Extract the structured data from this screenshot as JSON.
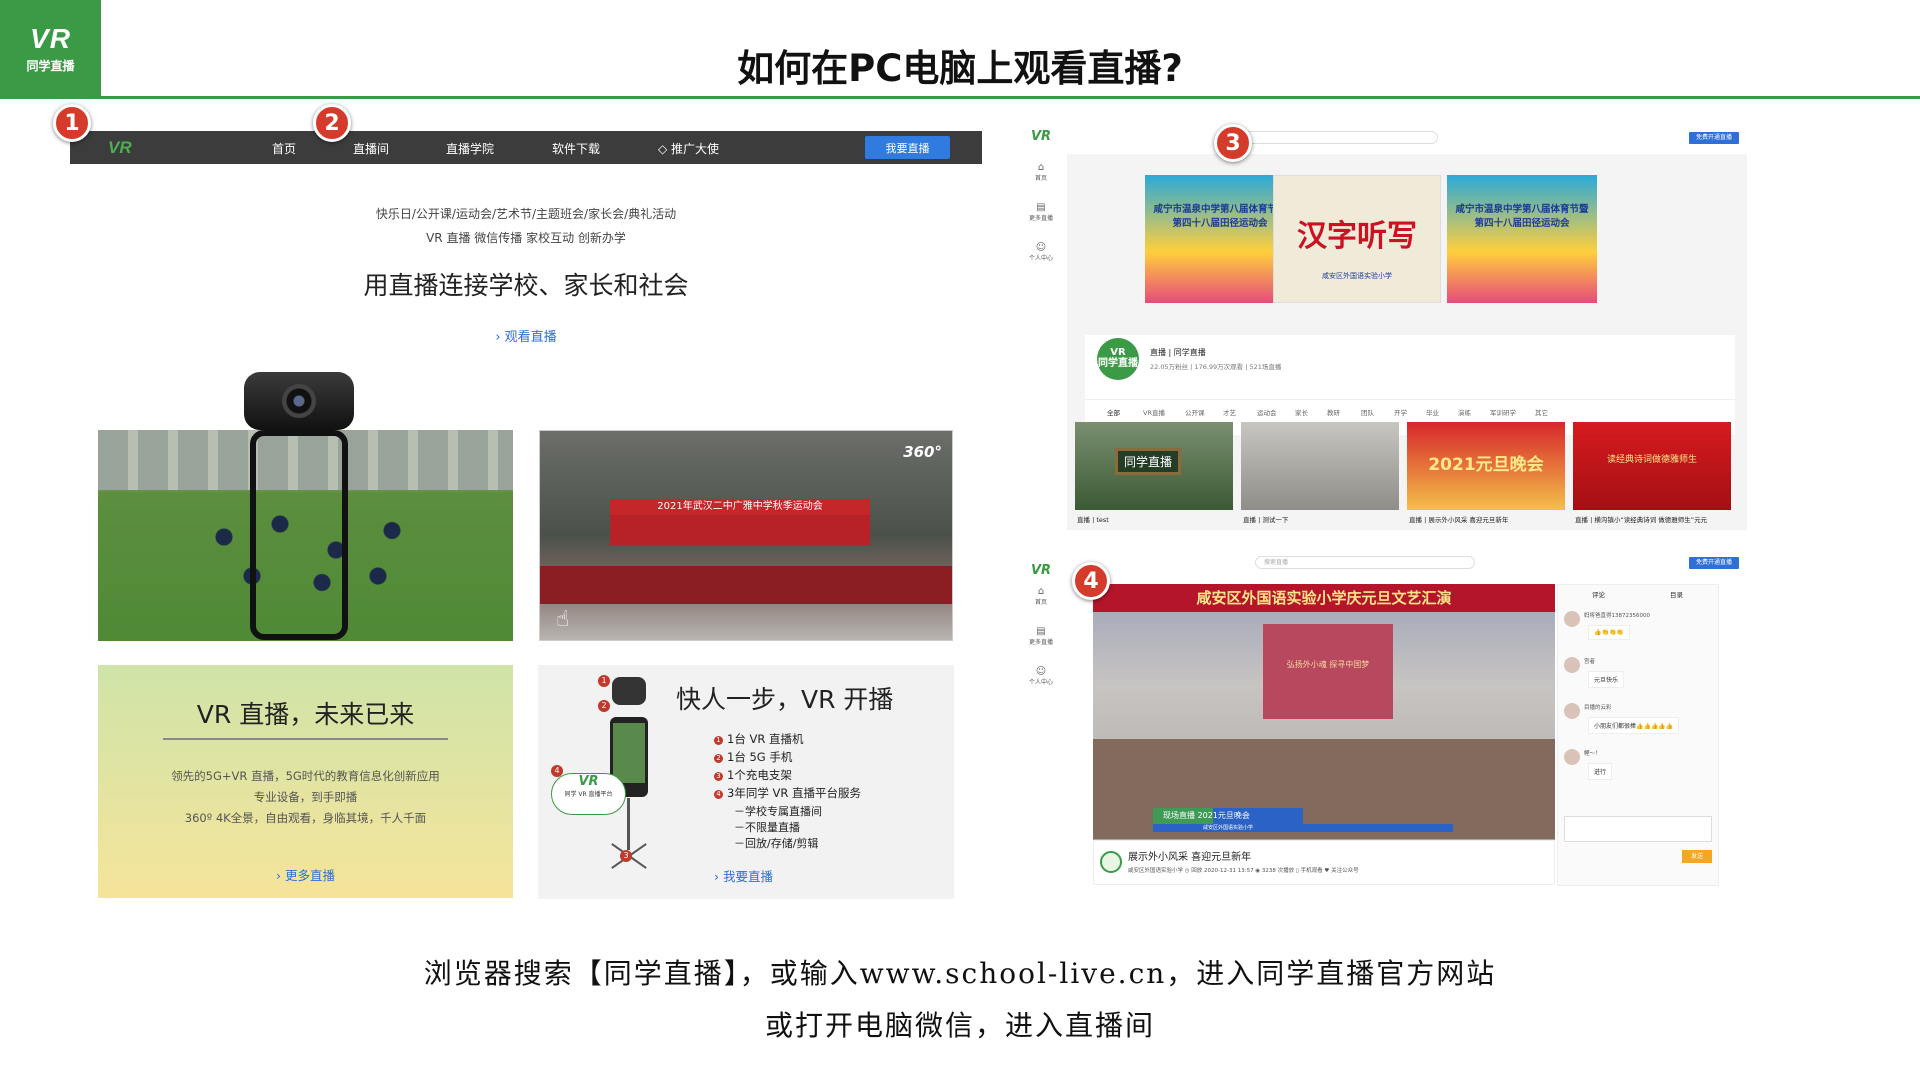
{
  "logo": {
    "mark": "VR",
    "name": "同学直播"
  },
  "title": "如何在PC电脑上观看直播?",
  "markers": [
    "1",
    "2",
    "3",
    "4"
  ],
  "site": {
    "nav": [
      "首页",
      "直播间",
      "直播学院",
      "软件下载",
      "推广大使"
    ],
    "nav_logo": "VR",
    "cta": "我要直播",
    "tagline1": "快乐日/公开课/运动会/艺术节/主题班会/家长会/典礼活动",
    "tagline2": "VR 直播  微信传播  家校互动  创新办学",
    "headline": "用直播连接学校、家长和社会",
    "watch": "观看直播",
    "img_right_banner": "2021年武汉二中广雅中学秋季运动会",
    "badge360": "360°",
    "cardA": {
      "title": "VR 直播，未来已来",
      "lines": [
        "领先的5G+VR 直播，5G时代的教育信息化创新应用",
        "专业设备，到手即播",
        "360º 4K全景，自由观看，身临其境，千人千面"
      ],
      "more": "更多直播"
    },
    "cardB": {
      "title": "快人一步，VR 开播",
      "items": [
        "1台 VR 直播机",
        "1台 5G 手机",
        "1个充电支架",
        "3年同学 VR 直播平台服务"
      ],
      "subs": [
        "－学校专属直播间",
        "－不限量直播",
        "－回放/存储/剪辑"
      ],
      "more": "我要直播",
      "cloud": "VR",
      "cloud_sub": "同学 VR 直播平台",
      "nums": [
        "1",
        "2",
        "3",
        "4"
      ]
    }
  },
  "shot1": {
    "logo": "VR",
    "side": [
      {
        "icon": "⌂",
        "label": "首页"
      },
      {
        "icon": "▤",
        "label": "更多直播"
      },
      {
        "icon": "☺",
        "label": "个人中心"
      }
    ],
    "search": "搜索直播",
    "btn": "免费开通直播",
    "car1": "咸宁市温泉中学第八届体育节暨第四十八届田径运动会",
    "car2": "汉字听写",
    "car2_sub": "咸安区外国语实验小学",
    "car3": "咸宁市温泉中学第八届体育节暨第四十八届田径运动会",
    "channel": {
      "avatar": "VR\n同学直播",
      "name": "直播 | 同学直播",
      "stats": "22.05万粉丝 | 176.99万次观看 | 521场直播"
    },
    "tabs": [
      "全部",
      "VR直播",
      "公开课",
      "才艺",
      "运动会",
      "家长",
      "教研",
      "团队",
      "开学",
      "毕业",
      "演练",
      "军训研学",
      "其它"
    ],
    "videos": [
      "直播 | test",
      "直播 | 测试一下",
      "直播 | 展示外小风采 喜迎元旦新年",
      "直播 | 横沟镇小“读经典诗词 做德雅师生”元元"
    ],
    "thumb_text": [
      "同学直播",
      "",
      "2021元旦晚会",
      "读经典诗词做德雅师生"
    ]
  },
  "shot2": {
    "logo": "VR",
    "side": [
      {
        "icon": "⌂",
        "label": "首页"
      },
      {
        "icon": "▤",
        "label": "更多直播"
      },
      {
        "icon": "☺",
        "label": "个人中心"
      }
    ],
    "search": "搜索直播",
    "btn": "免费开通直播",
    "banner": "咸安区外国语实验小学庆元旦文艺汇演",
    "screen": "弘扬外小魂 探寻中国梦",
    "lower": "现场直播  2021元旦晚会",
    "lower2": "咸安区外国语实验小学",
    "video_title": "展示外小风采 喜迎元旦新年",
    "meta": "咸安区外国语实验小学  ◷ 回放  2020-12-31 13:57  ◉ 3238 次播放  ▯ 手机观看  ♥ 关注公众号",
    "tabs": [
      "评论",
      "目录"
    ],
    "comments": [
      {
        "name": "妈将爸直得13872356000",
        "text": "👍👏👏👏"
      },
      {
        "name": "宫者",
        "text": "元旦快乐"
      },
      {
        "name": "目播的云彩",
        "text": "小朋友们都很棒👍👍👍👍👍"
      },
      {
        "name": "鲤～！",
        "text": "迸行"
      }
    ],
    "send": "发送"
  },
  "caption1": "浏览器搜索【同学直播】，或输入www.school-live.cn，进入同学直播官方网站",
  "caption2": "或打开电脑微信，进入直播间",
  "colors": {
    "brand": "#3a9a45",
    "marker": "#d43b2b",
    "link": "#2f6fd8"
  }
}
